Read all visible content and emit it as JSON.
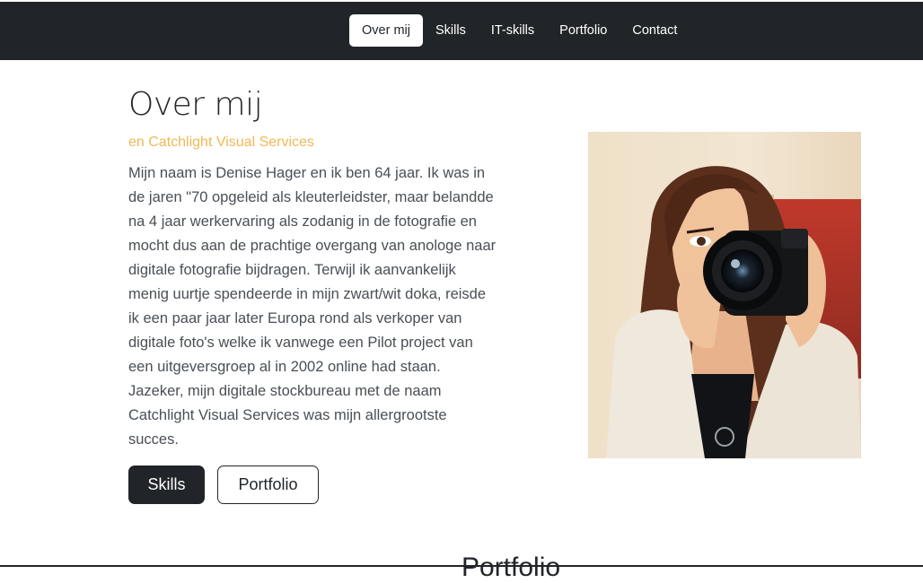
{
  "nav": {
    "items": [
      {
        "label": "Over mij"
      },
      {
        "label": "Skills"
      },
      {
        "label": "IT-skills"
      },
      {
        "label": "Portfolio"
      },
      {
        "label": "Contact"
      }
    ],
    "active_index": 0
  },
  "about": {
    "title": "Over mij",
    "subtitle": "en Catchlight Visual Services",
    "paragraph": "Mijn naam is Denise Hager en ik ben 64 jaar. Ik was in de jaren \"70 opgeleid als kleuterleidster, maar belandde na 4 jaar werkervaring als zodanig in de fotografie en mocht dus aan de prachtige overgang van anologe naar digitale fotografie bijdragen. Terwijl ik aanvankelijk menig uurtje spendeerde in mijn zwart/wit doka, reisde ik een paar jaar later Europa rond als verkoper van digitale foto's welke ik vanwege een Pilot project van een uitgeversgroep al in 2002 online had staan. Jazeker, mijn digitale stockbureau met de naam Catchlight Visual Services was mijn allergrootste succes.",
    "buttons": {
      "primary": "Skills",
      "secondary": "Portfolio"
    }
  },
  "next_section": {
    "title": "Portfolio"
  },
  "colors": {
    "navbar": "#212529",
    "accent": "#f0b955"
  }
}
